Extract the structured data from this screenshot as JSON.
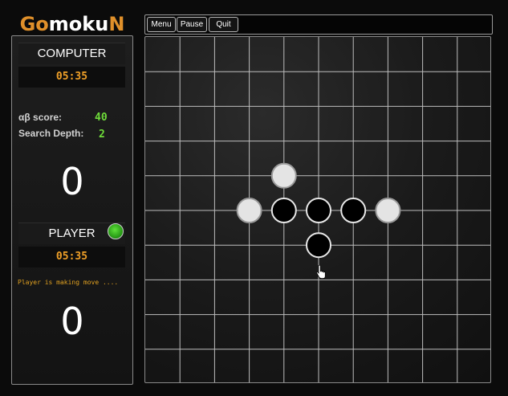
{
  "app": {
    "title_part1": "Go",
    "title_part2": "moku",
    "title_part3": "N"
  },
  "toolbar": {
    "menu_label": "Menu",
    "pause_label": "Pause",
    "quit_label": "Quit"
  },
  "computer": {
    "name": "COMPUTER",
    "time": "05:35",
    "alpha_beta_label": "αβ score:",
    "alpha_beta_value": "40",
    "search_depth_label": "Search Depth:",
    "search_depth_value": "2",
    "score": "0"
  },
  "player": {
    "name": "PLAYER",
    "time": "05:35",
    "status": "Player is making move ....",
    "score": "0",
    "turn_indicator_color": "#2ea31a"
  },
  "board": {
    "columns": 10,
    "rows": 10,
    "stones": [
      {
        "color": "white",
        "col": 4,
        "row": 4
      },
      {
        "color": "white",
        "col": 3,
        "row": 5
      },
      {
        "color": "black",
        "col": 4,
        "row": 5
      },
      {
        "color": "black",
        "col": 5,
        "row": 5
      },
      {
        "color": "black",
        "col": 6,
        "row": 5
      },
      {
        "color": "white",
        "col": 7,
        "row": 5
      },
      {
        "color": "black",
        "col": 5,
        "row": 6
      }
    ]
  }
}
